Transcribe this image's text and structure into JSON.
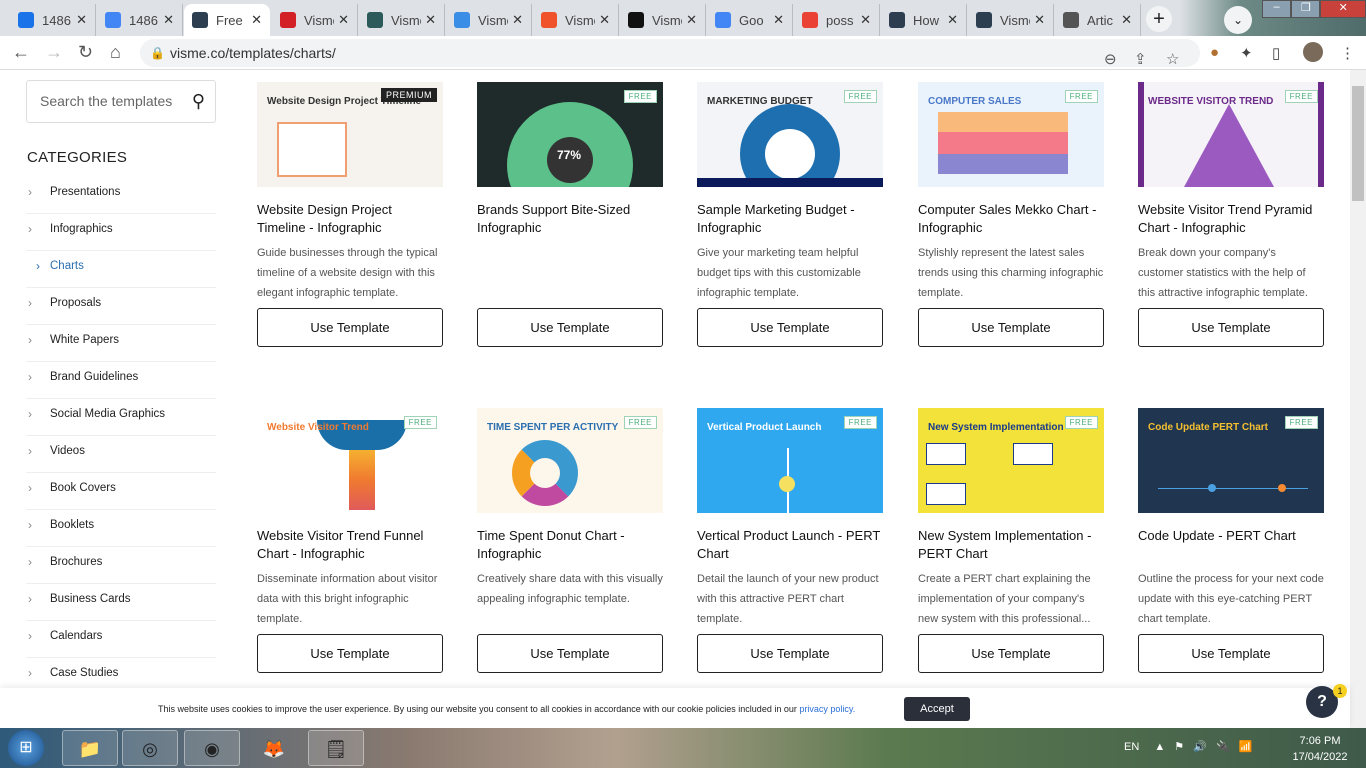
{
  "browser": {
    "tabs": [
      {
        "title": "1486",
        "icon": "infinity-icon",
        "color": "#1a73e8"
      },
      {
        "title": "1486",
        "icon": "docs-icon",
        "color": "#4285f4"
      },
      {
        "title": "Free",
        "icon": "visme-icon",
        "color": "#2c3e50",
        "active": true
      },
      {
        "title": "Visme",
        "icon": "pc-icon",
        "color": "#d31f26"
      },
      {
        "title": "Visme",
        "icon": "chat-icon",
        "color": "#2c5a5a"
      },
      {
        "title": "Visme",
        "icon": "arrow-icon",
        "color": "#3a8ee6"
      },
      {
        "title": "Visme",
        "icon": "g2-icon",
        "color": "#f0522c"
      },
      {
        "title": "Visme",
        "icon": "clock-icon",
        "color": "#111"
      },
      {
        "title": "Goo",
        "icon": "translate-icon",
        "color": "#4285f4"
      },
      {
        "title": "poss",
        "icon": "google-icon",
        "color": "#ea4335"
      },
      {
        "title": "How",
        "icon": "visme-icon",
        "color": "#2c3e50"
      },
      {
        "title": "Visme",
        "icon": "visme-icon",
        "color": "#2c3e50"
      },
      {
        "title": "Artic",
        "icon": "globe-icon",
        "color": "#555"
      }
    ],
    "url": "visme.co/templates/charts/"
  },
  "sidebar": {
    "search_placeholder": "Search the templates",
    "categories_title": "CATEGORIES",
    "items": [
      "Presentations",
      "Infographics",
      "Charts",
      "Proposals",
      "White Papers",
      "Brand Guidelines",
      "Social Media Graphics",
      "Videos",
      "Book Covers",
      "Booklets",
      "Brochures",
      "Business Cards",
      "Calendars",
      "Case Studies"
    ],
    "active": "Charts"
  },
  "cards": [
    {
      "badge": "PREMIUM",
      "thumb_text": "Website Design Project Timeline",
      "bg": "#f6f3ef",
      "fg": "#333",
      "title": "Website Design Project Timeline - Infographic",
      "desc": "Guide businesses through the typical timeline of a website design with this elegant infographic template.",
      "button": "Use Template"
    },
    {
      "badge": "FREE",
      "thumb_text": "77%",
      "bg": "#1f2a2a",
      "fg": "#fff",
      "title": "Brands Support Bite-Sized Infographic",
      "desc": "",
      "button": "Use Template"
    },
    {
      "badge": "FREE",
      "thumb_text": "MARKETING BUDGET",
      "bg": "#f3f4f8",
      "fg": "#333",
      "title": "Sample Marketing Budget - Infographic",
      "desc": "Give your marketing team helpful budget tips with this customizable infographic template.",
      "button": "Use Template"
    },
    {
      "badge": "FREE",
      "thumb_text": "COMPUTER SALES",
      "bg": "#eaf3fb",
      "fg": "#4a78c8",
      "title": "Computer Sales Mekko Chart - Infographic",
      "desc": "Stylishly represent the latest sales trends using this charming infographic template.",
      "button": "Use Template"
    },
    {
      "badge": "FREE",
      "thumb_text": "WEBSITE VISITOR TREND",
      "bg": "#f5f2f8",
      "fg": "#6b2a8a",
      "title": "Website Visitor Trend Pyramid Chart - Infographic",
      "desc": "Break down your company's customer statistics with the help of this attractive infographic template.",
      "button": "Use Template"
    },
    {
      "badge": "FREE",
      "thumb_text": "Website Visitor Trend",
      "bg": "#ffffff",
      "fg": "#f07a30",
      "title": "Website Visitor Trend Funnel Chart - Infographic",
      "desc": "Disseminate information about visitor data with this bright infographic template.",
      "button": "Use Template"
    },
    {
      "badge": "FREE",
      "thumb_text": "TIME SPENT PER ACTIVITY",
      "bg": "#fdf6ea",
      "fg": "#2a6fb0",
      "title": "Time Spent Donut Chart - Infographic",
      "desc": "Creatively share data with this visually appealing infographic template.",
      "button": "Use Template"
    },
    {
      "badge": "FREE",
      "thumb_text": "Vertical Product Launch",
      "bg": "#2fa8f0",
      "fg": "#fff",
      "title": "Vertical Product Launch - PERT Chart",
      "desc": "Detail the launch of your new product with this attractive PERT chart template.",
      "button": "Use Template"
    },
    {
      "badge": "FREE",
      "thumb_text": "New System Implementation",
      "bg": "#f2e23a",
      "fg": "#1a3a8a",
      "title": "New System Implementation - PERT Chart",
      "desc": "Create a PERT chart explaining the implementation of your company's new system with this professional...",
      "button": "Use Template"
    },
    {
      "badge": "FREE",
      "thumb_text": "Code Update PERT Chart",
      "bg": "#1f3550",
      "fg": "#f5c030",
      "title": "Code Update - PERT Chart",
      "desc": "Outline the process for your next code update with this eye-catching PERT chart template.",
      "button": "Use Template"
    }
  ],
  "cookie": {
    "message": "This website uses cookies to improve the user experience. By using our website you consent to all cookies in accordance with our cookie policies included in our ",
    "link": "privacy policy.",
    "accept": "Accept"
  },
  "help": {
    "label": "?",
    "count": "1"
  },
  "taskbar": {
    "lang": "EN",
    "time": "7:06 PM",
    "date": "17/04/2022"
  }
}
